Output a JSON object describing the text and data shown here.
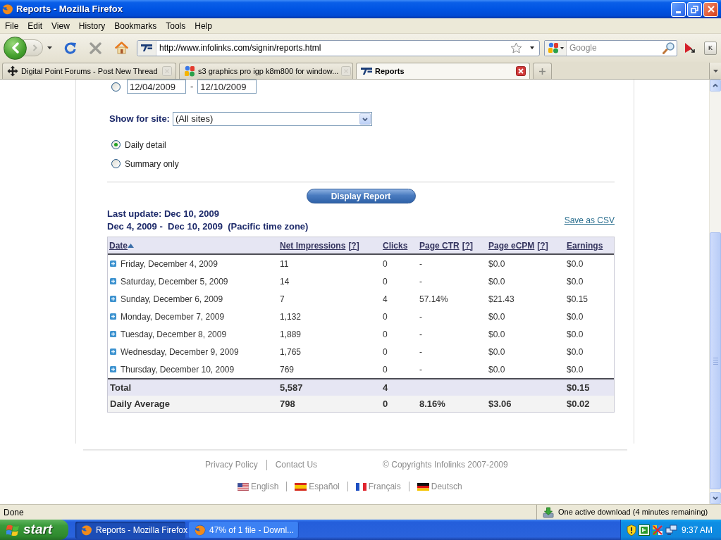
{
  "window": {
    "title": "Reports - Mozilla Firefox"
  },
  "menu_bar": [
    "File",
    "Edit",
    "View",
    "History",
    "Bookmarks",
    "Tools",
    "Help"
  ],
  "toolbar": {
    "url": "http://www.infolinks.com/signin/reports.html",
    "search": {
      "placeholder": "Google"
    },
    "extra_button": "K"
  },
  "tabs": [
    {
      "title": "Digital Point Forums - Post New Thread",
      "selected": false
    },
    {
      "title": "s3 graphics pro igp k8m800 for window...",
      "selected": false
    },
    {
      "title": "Reports",
      "selected": true
    }
  ],
  "page": {
    "date_range": {
      "selected": false,
      "from": "12/04/2009",
      "separator": "-",
      "to": "12/10/2009"
    },
    "site_filter": {
      "label": "Show for site:",
      "value": "(All sites)"
    },
    "view_options": [
      {
        "label": "Daily detail",
        "selected": true
      },
      {
        "label": "Summary only",
        "selected": false
      }
    ],
    "display_button": "Display Report",
    "last_update": "Last update: Dec 10, 2009",
    "period": "Dec 4, 2009 -  Dec 10, 2009  (Pacific time zone)",
    "save_link": "Save as CSV",
    "table": {
      "columns": [
        {
          "label": "Date",
          "sorted": true
        },
        {
          "label": "Net Impressions",
          "help": "[?]",
          "sorted": false
        },
        {
          "label": "Clicks",
          "sorted": false
        },
        {
          "label": "Page CTR",
          "help": "[?]",
          "sorted": false
        },
        {
          "label": "Page eCPM",
          "help": "[?]",
          "sorted": false
        },
        {
          "label": "Earnings",
          "sorted": false
        }
      ],
      "rows": [
        {
          "expanded": false,
          "date": "Friday, December 4, 2009",
          "net_impressions": "11",
          "clicks": "0",
          "page_ctr": "-",
          "page_ecpm": "$0.0",
          "earnings": "$0.0"
        },
        {
          "expanded": false,
          "date": "Saturday, December 5, 2009",
          "net_impressions": "14",
          "clicks": "0",
          "page_ctr": "-",
          "page_ecpm": "$0.0",
          "earnings": "$0.0"
        },
        {
          "expanded": false,
          "date": "Sunday, December 6, 2009",
          "net_impressions": "7",
          "clicks": "4",
          "page_ctr": "57.14%",
          "page_ecpm": "$21.43",
          "earnings": "$0.15"
        },
        {
          "expanded": false,
          "date": "Monday, December 7, 2009",
          "net_impressions": "1,132",
          "clicks": "0",
          "page_ctr": "-",
          "page_ecpm": "$0.0",
          "earnings": "$0.0"
        },
        {
          "expanded": false,
          "date": "Tuesday, December 8, 2009",
          "net_impressions": "1,889",
          "clicks": "0",
          "page_ctr": "-",
          "page_ecpm": "$0.0",
          "earnings": "$0.0"
        },
        {
          "expanded": false,
          "date": "Wednesday, December 9, 2009",
          "net_impressions": "1,765",
          "clicks": "0",
          "page_ctr": "-",
          "page_ecpm": "$0.0",
          "earnings": "$0.0"
        },
        {
          "expanded": false,
          "date": "Thursday, December 10, 2009",
          "net_impressions": "769",
          "clicks": "0",
          "page_ctr": "-",
          "page_ecpm": "$0.0",
          "earnings": "$0.0"
        }
      ],
      "summary": [
        {
          "kind": "total",
          "label": "Total",
          "net_impressions": "5,587",
          "clicks": "4",
          "earnings": "$0.15"
        },
        {
          "kind": "average",
          "label": "Daily Average",
          "net_impressions": "798",
          "clicks": "0",
          "page_ctr": "8.16%",
          "page_ecpm": "$3.06",
          "earnings": "$0.02"
        }
      ]
    }
  },
  "footer": {
    "links": [
      "Privacy Policy",
      "Contact Us"
    ],
    "copyright": "© Copyrights Infolinks 2007-2009",
    "languages": [
      "English",
      "Español",
      "Français",
      "Deutsch"
    ]
  },
  "status_bar": {
    "text": "Done",
    "download": "One active download (4 minutes remaining)"
  },
  "taskbar": {
    "start": "start",
    "tasks": [
      {
        "label": "Reports - Mozilla Firefox",
        "selected": true
      },
      {
        "label": "47% of 1 file - Downl...",
        "selected": false
      }
    ],
    "clock": "9:37 AM"
  }
}
